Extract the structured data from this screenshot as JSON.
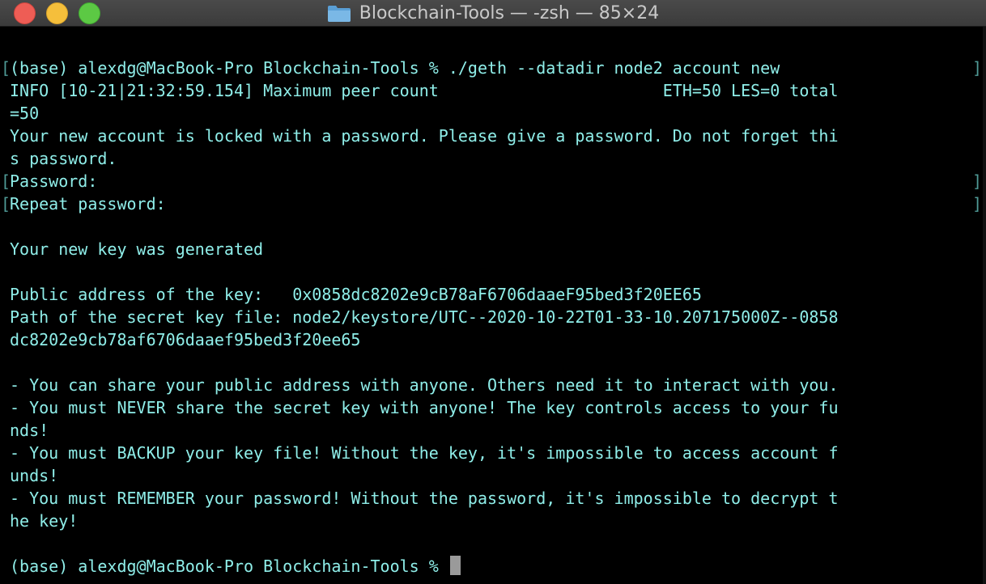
{
  "window": {
    "title": "Blockchain-Tools — -zsh — 85×24"
  },
  "terminal": {
    "lines": [
      {
        "text": "(base) alexdg@MacBook-Pro Blockchain-Tools % ./geth --datadir node2 account new",
        "bracket_left": "[",
        "bracket_right": "]"
      },
      {
        "text": "INFO [10-21|21:32:59.154] Maximum peer count                       ETH=50 LES=0 total",
        "bracket_left": "",
        "bracket_right": ""
      },
      {
        "text": "=50",
        "bracket_left": "",
        "bracket_right": ""
      },
      {
        "text": "Your new account is locked with a password. Please give a password. Do not forget thi",
        "bracket_left": "",
        "bracket_right": ""
      },
      {
        "text": "s password.",
        "bracket_left": "",
        "bracket_right": ""
      },
      {
        "text": "Password:",
        "bracket_left": "[",
        "bracket_right": "]"
      },
      {
        "text": "Repeat password:",
        "bracket_left": "[",
        "bracket_right": "]"
      },
      {
        "text": "",
        "bracket_left": "",
        "bracket_right": ""
      },
      {
        "text": "Your new key was generated",
        "bracket_left": "",
        "bracket_right": ""
      },
      {
        "text": "",
        "bracket_left": "",
        "bracket_right": ""
      },
      {
        "text": "Public address of the key:   0x0858dc8202e9cB78aF6706daaeF95bed3f20EE65",
        "bracket_left": "",
        "bracket_right": ""
      },
      {
        "text": "Path of the secret key file: node2/keystore/UTC--2020-10-22T01-33-10.207175000Z--0858",
        "bracket_left": "",
        "bracket_right": ""
      },
      {
        "text": "dc8202e9cb78af6706daaef95bed3f20ee65",
        "bracket_left": "",
        "bracket_right": ""
      },
      {
        "text": "",
        "bracket_left": "",
        "bracket_right": ""
      },
      {
        "text": "- You can share your public address with anyone. Others need it to interact with you.",
        "bracket_left": "",
        "bracket_right": ""
      },
      {
        "text": "- You must NEVER share the secret key with anyone! The key controls access to your fu",
        "bracket_left": "",
        "bracket_right": ""
      },
      {
        "text": "nds!",
        "bracket_left": "",
        "bracket_right": ""
      },
      {
        "text": "- You must BACKUP your key file! Without the key, it's impossible to access account f",
        "bracket_left": "",
        "bracket_right": ""
      },
      {
        "text": "unds!",
        "bracket_left": "",
        "bracket_right": ""
      },
      {
        "text": "- You must REMEMBER your password! Without the password, it's impossible to decrypt t",
        "bracket_left": "",
        "bracket_right": ""
      },
      {
        "text": "he key!",
        "bracket_left": "",
        "bracket_right": ""
      },
      {
        "text": "",
        "bracket_left": "",
        "bracket_right": ""
      }
    ],
    "prompt": "(base) alexdg@MacBook-Pro Blockchain-Tools % "
  },
  "colors": {
    "text": "#8feee9",
    "background": "#000000",
    "titlebar": "#3b3b3b",
    "close": "#ee5d55",
    "minimize": "#f5bf3b",
    "maximize": "#5cc944",
    "folder": "#6aaee0"
  },
  "icons": {
    "title_icon": "folder-icon"
  }
}
